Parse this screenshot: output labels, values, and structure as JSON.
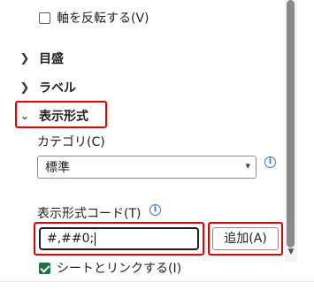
{
  "panel": {
    "axis_reverse": {
      "label": "軸を反転する(V)",
      "checked": false
    },
    "sections": [
      {
        "label": "目盛",
        "expanded": false
      },
      {
        "label": "ラベル",
        "expanded": false
      },
      {
        "label": "表示形式",
        "expanded": true
      }
    ],
    "category": {
      "label": "カテゴリ(C)",
      "selected": "標準"
    },
    "format_code": {
      "label": "表示形式コード(T)",
      "value": "#,##0;",
      "add_button": "追加(A)"
    },
    "link_source": {
      "label": "シートとリンクする(I)",
      "checked": true
    }
  },
  "icons": {
    "collapsed": "chevron-right-icon",
    "expanded": "chevron-down-icon",
    "info": "info-icon",
    "dropdown": "chevron-down-icon"
  },
  "colors": {
    "highlight": "#e60000",
    "checkbox_checked": "#1e7145",
    "info": "#2e74d1"
  }
}
